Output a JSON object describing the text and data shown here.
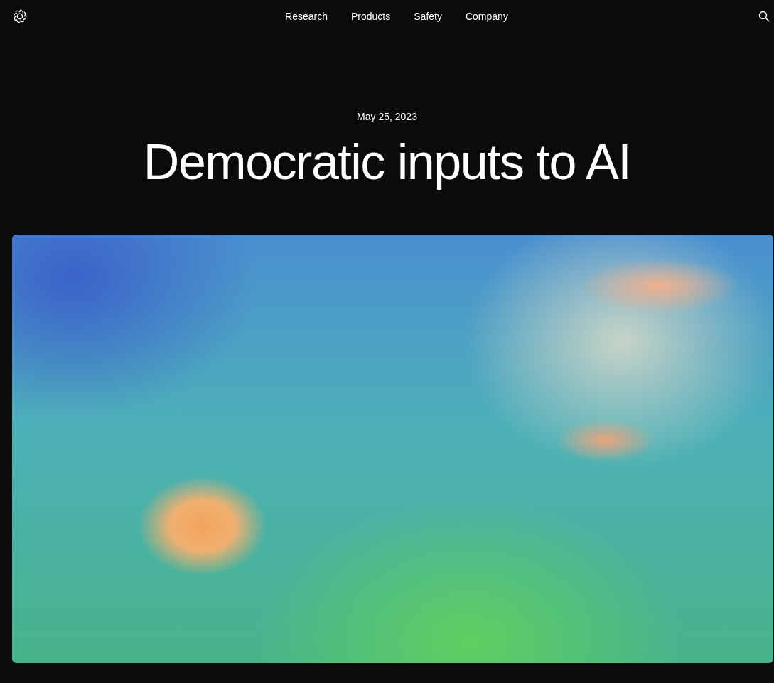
{
  "nav": {
    "links": [
      {
        "label": "Research"
      },
      {
        "label": "Products"
      },
      {
        "label": "Safety"
      },
      {
        "label": "Company"
      }
    ]
  },
  "hero": {
    "date": "May 25, 2023",
    "title": "Democratic inputs to AI"
  }
}
